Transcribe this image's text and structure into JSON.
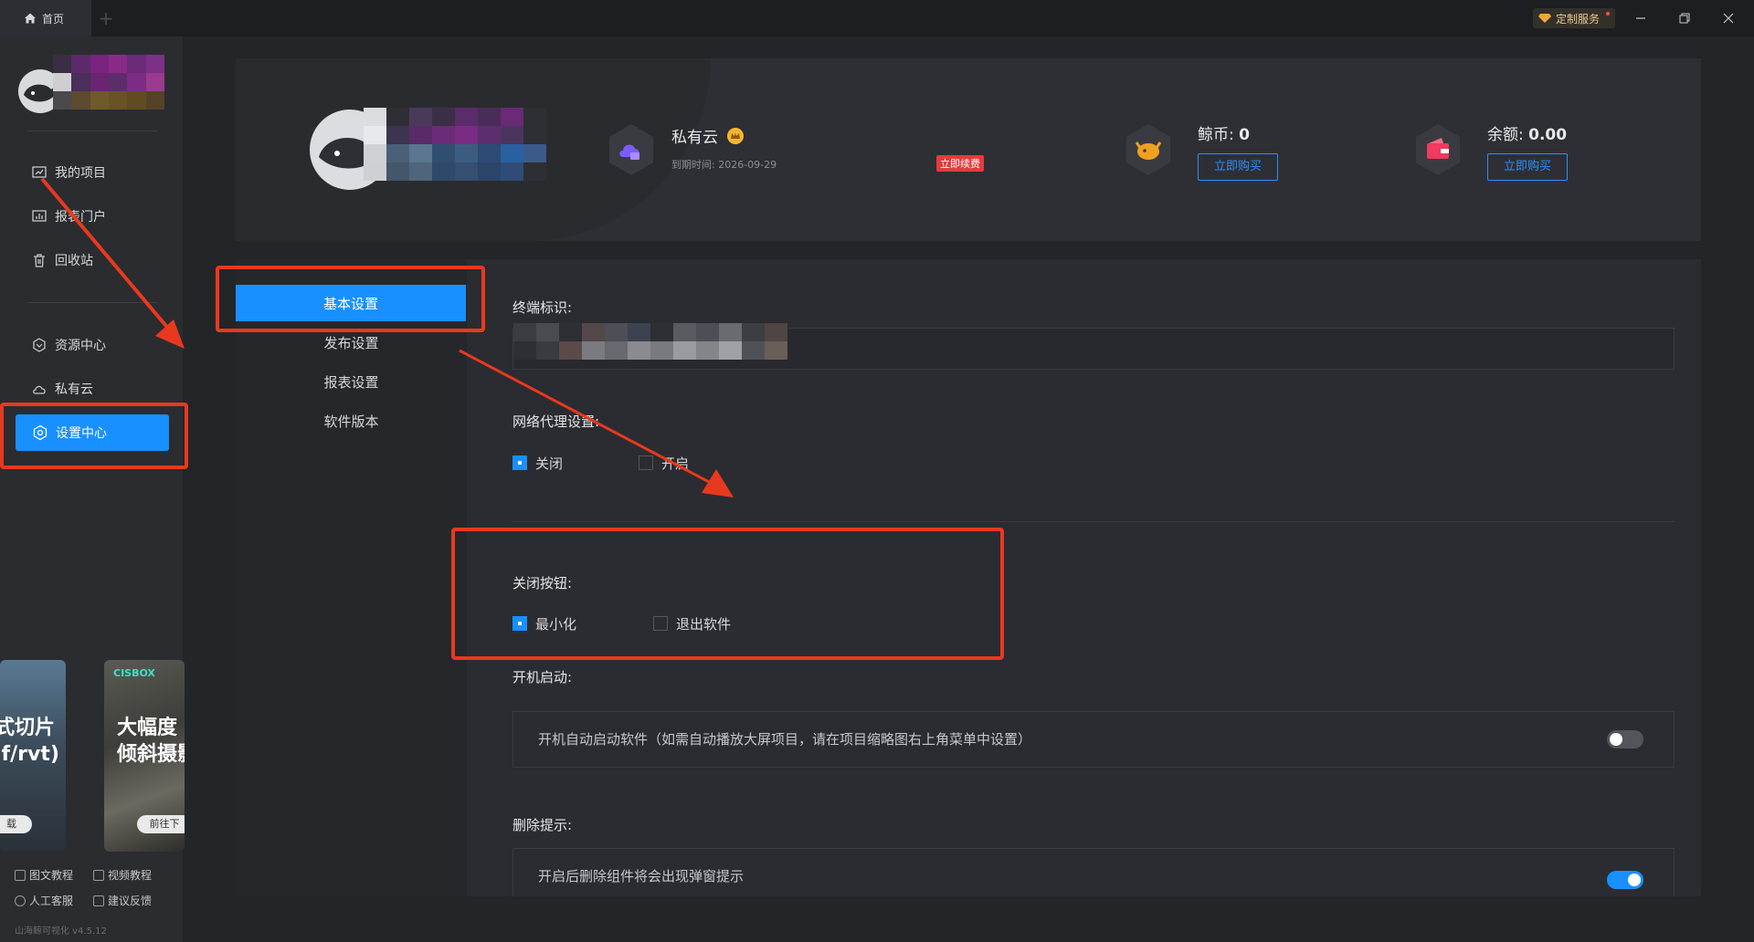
{
  "titlebar": {
    "home_tab": "首页",
    "add_tab": "+",
    "custom_service": "定制服务"
  },
  "sidebar": {
    "nav": [
      {
        "label": "我的项目",
        "icon": "project-icon"
      },
      {
        "label": "报表门户",
        "icon": "report-icon"
      },
      {
        "label": "回收站",
        "icon": "trash-icon"
      },
      {
        "label": "资源中心",
        "icon": "resource-icon"
      },
      {
        "label": "私有云",
        "icon": "cloud-icon"
      },
      {
        "label": "设置中心",
        "icon": "settings-icon",
        "active": true
      }
    ],
    "promo_left": {
      "line1": "式切片",
      "line2": "if/rvt)",
      "button": "载"
    },
    "promo_right": {
      "brand": "CISBOX",
      "line1": "大幅度",
      "line2": "倾斜摄影",
      "button": "前往下"
    },
    "footer_links": [
      "图文教程",
      "视频教程",
      "人工客服",
      "建议反馈"
    ],
    "version": "山海鲸可视化 v4.5.12"
  },
  "header": {
    "private_cloud": {
      "title": "私有云",
      "expire_label": "到期时间: 2026-09-29",
      "renew": "立即续费"
    },
    "coins": {
      "label": "鲸币: ",
      "value": "0",
      "button": "立即购买"
    },
    "balance": {
      "label": "余额: ",
      "value": "0.00",
      "button": "立即购买"
    }
  },
  "settings_nav": [
    {
      "label": "基本设置",
      "active": true
    },
    {
      "label": "发布设置"
    },
    {
      "label": "报表设置"
    },
    {
      "label": "软件版本"
    }
  ],
  "settings": {
    "terminal_id_label": "终端标识:",
    "proxy": {
      "label": "网络代理设置:",
      "options": [
        "关闭",
        "开启"
      ],
      "selected": 0
    },
    "close_button": {
      "label": "关闭按钮:",
      "options": [
        "最小化",
        "退出软件"
      ],
      "selected": 0
    },
    "autostart": {
      "label": "开机启动:",
      "text": "开机自动启动软件（如需自动播放大屏项目，请在项目缩略图右上角菜单中设置）",
      "enabled": false
    },
    "delete_prompt": {
      "label": "删除提示:",
      "text": "开启后删除组件将会出现弹窗提示",
      "enabled": true
    }
  },
  "colors": {
    "accent": "#1890ff",
    "annotation": "#e8391e",
    "renew": "#e33c3c"
  }
}
